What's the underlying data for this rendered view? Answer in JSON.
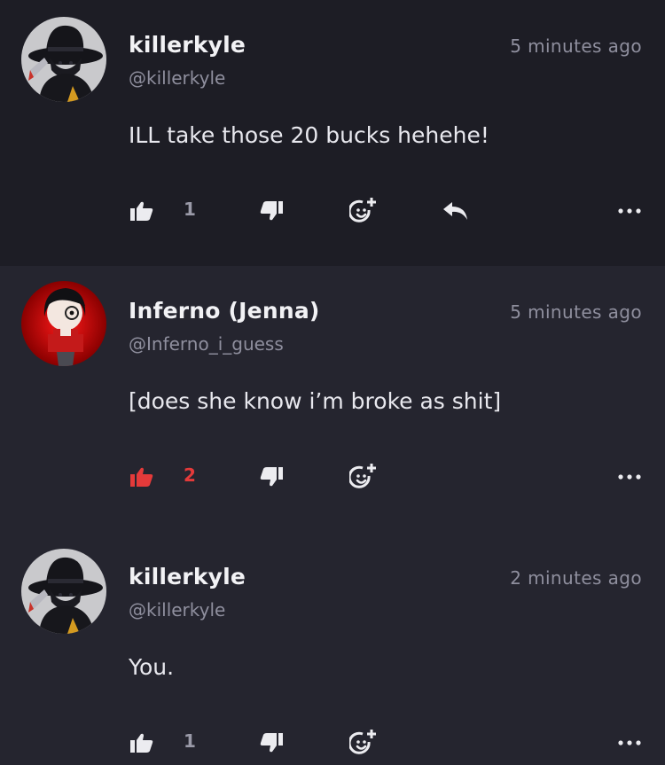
{
  "colors": {
    "accent_red": "#e43a3a",
    "text_primary": "#f2f2f5",
    "text_secondary": "#8f8f9e",
    "bg_highlight": "#1d1d25",
    "bg": "#25252f"
  },
  "comments": [
    {
      "avatar_icon": "hat-character-avatar",
      "username": "killerkyle",
      "handle": "@killerkyle",
      "time": "5 minutes ago",
      "text": "ILL take those 20 bucks hehehe!",
      "likes": "1",
      "liked": false,
      "has_reply": true
    },
    {
      "avatar_icon": "red-character-avatar",
      "username": "Inferno (Jenna)",
      "handle": "@Inferno_i_guess",
      "time": "5 minutes ago",
      "text": "[does she know i’m broke as shit]",
      "likes": "2",
      "liked": true,
      "has_reply": false
    },
    {
      "avatar_icon": "hat-character-avatar",
      "username": "killerkyle",
      "handle": "@killerkyle",
      "time": "2 minutes ago",
      "text": "You.",
      "likes": "1",
      "liked": false,
      "has_reply": false
    }
  ],
  "icons": {
    "like": "thumbs-up-icon",
    "dislike": "thumbs-down-icon",
    "react": "add-reaction-icon",
    "reply": "reply-arrow-icon",
    "more": "more-dots-icon"
  }
}
